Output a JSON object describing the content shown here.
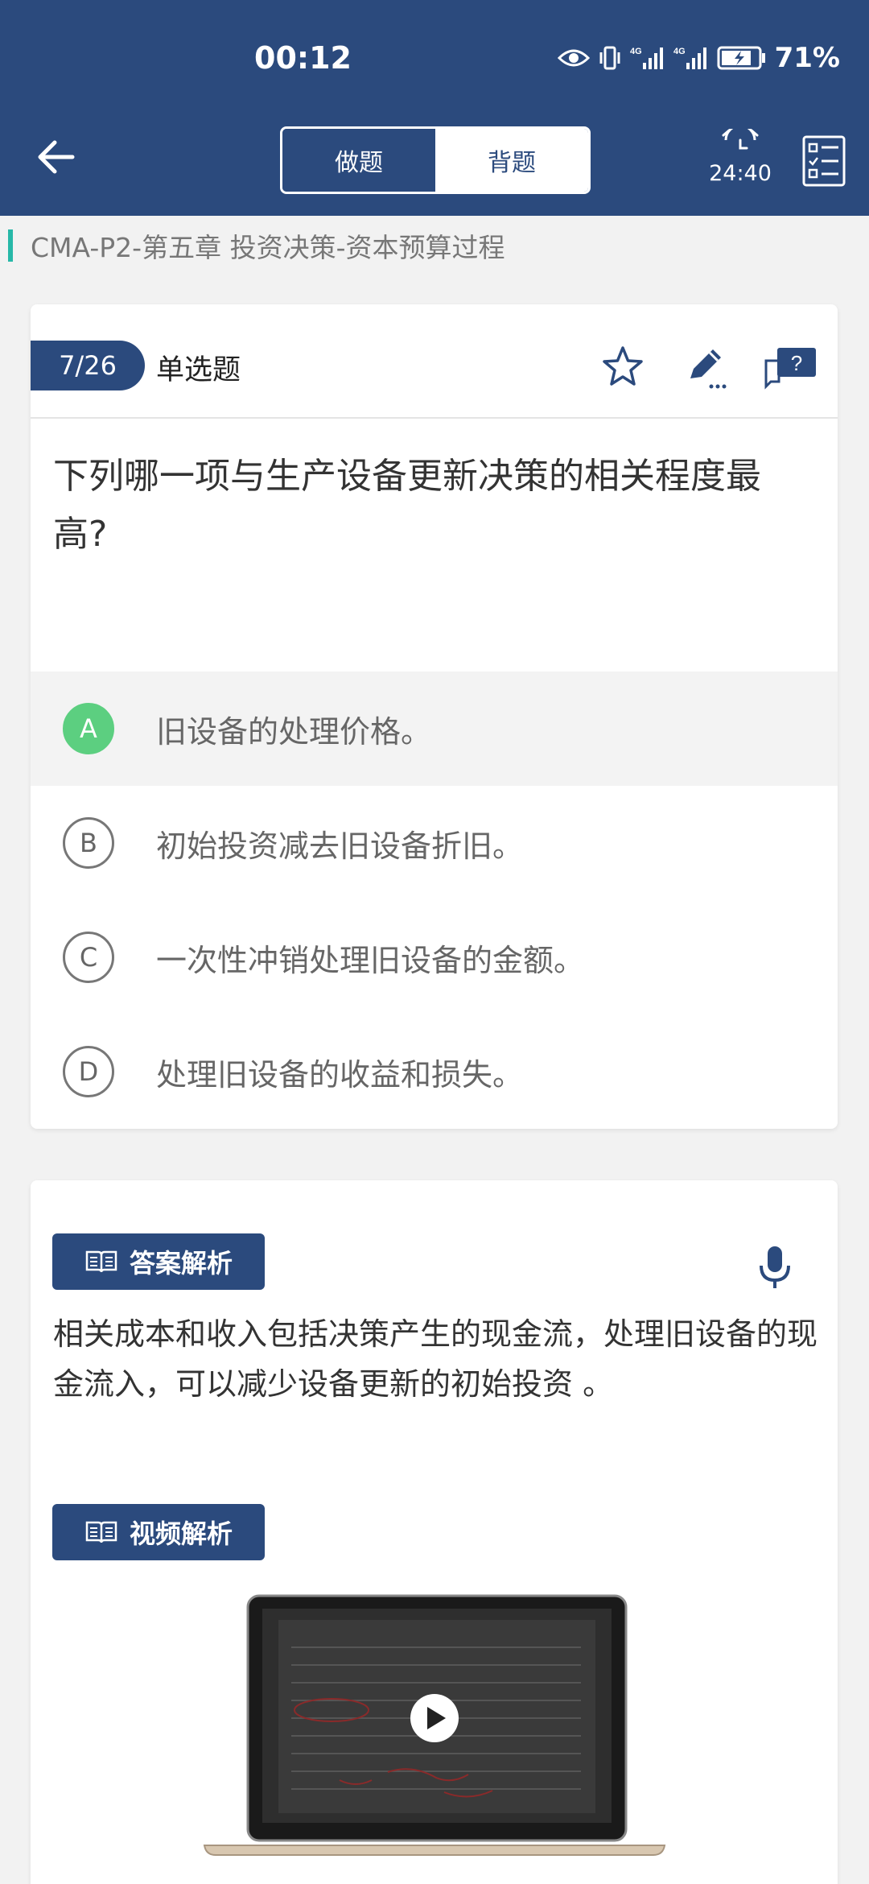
{
  "status_bar": {
    "time": "00:12",
    "battery": "71%",
    "network_labels": [
      "4G",
      "4G"
    ]
  },
  "header": {
    "tabs": [
      {
        "label": "做题"
      },
      {
        "label": "背题"
      }
    ],
    "active_tab": "背题",
    "timer": "24:40"
  },
  "breadcrumb": "CMA-P2-第五章  投资决策-资本预算过程",
  "question": {
    "number": "7/26",
    "type": "单选题",
    "text": "下列哪一项与生产设备更新决策的相关程度最高?",
    "options": [
      {
        "letter": "A",
        "text": "旧设备的处理价格。",
        "correct": true
      },
      {
        "letter": "B",
        "text": "初始投资减去旧设备折旧。"
      },
      {
        "letter": "C",
        "text": "一次性冲销处理旧设备的金额。"
      },
      {
        "letter": "D",
        "text": "处理旧设备的收益和损失。"
      }
    ]
  },
  "analysis": {
    "label": "答案解析",
    "text": "相关成本和收入包括决策产生的现金流，处理旧设备的现金流入，可以减少设备更新的初始投资 。"
  },
  "video_analysis": {
    "label": "视频解析"
  },
  "colors": {
    "primary": "#2b4a7d",
    "accent": "#27b8a8",
    "correct": "#5ccf80"
  }
}
